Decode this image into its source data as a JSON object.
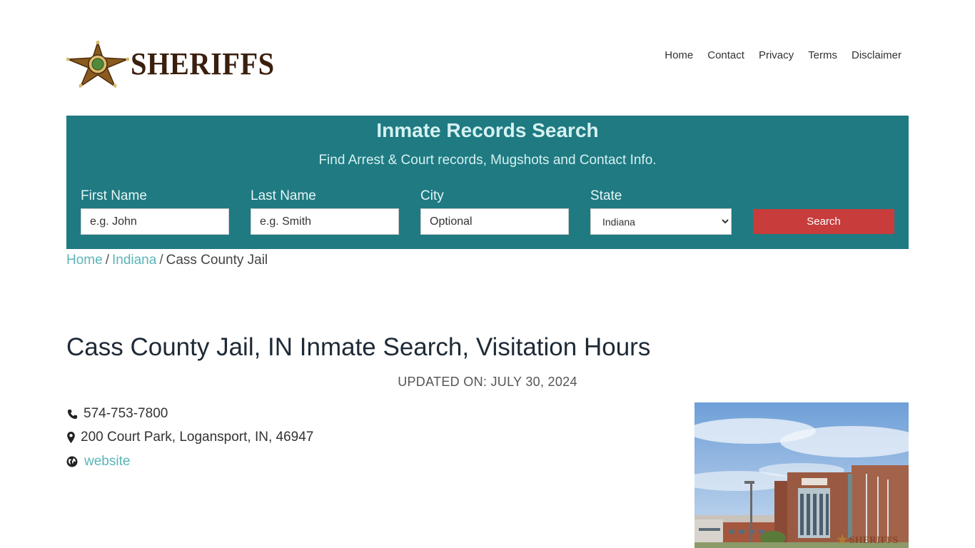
{
  "header": {
    "logo_text": "SHERIFFS",
    "nav": [
      "Home",
      "Contact",
      "Privacy",
      "Terms",
      "Disclaimer"
    ]
  },
  "search_panel": {
    "title": "Inmate Records Search",
    "subtitle": "Find Arrest & Court records, Mugshots and Contact Info.",
    "first_name_label": "First Name",
    "first_name_placeholder": "e.g. John",
    "last_name_label": "Last Name",
    "last_name_placeholder": "e.g. Smith",
    "city_label": "City",
    "city_placeholder": "Optional",
    "state_label": "State",
    "state_value": "Indiana",
    "search_button": "Search",
    "bg_color": "#1f7a82",
    "button_color": "#c83c3c"
  },
  "breadcrumb": {
    "home": "Home",
    "state": "Indiana",
    "current": "Cass County Jail",
    "separator": "/"
  },
  "page": {
    "title": "Cass County Jail, IN Inmate Search, Visitation Hours",
    "updated": "UPDATED ON: JULY 30, 2024"
  },
  "contact": {
    "phone": "574-753-7800",
    "address": "200 Court Park, Logansport, IN, 46947",
    "website": "website",
    "phone_icon": "phone-icon",
    "address_icon": "map-marker-icon",
    "website_icon": "globe-icon"
  }
}
